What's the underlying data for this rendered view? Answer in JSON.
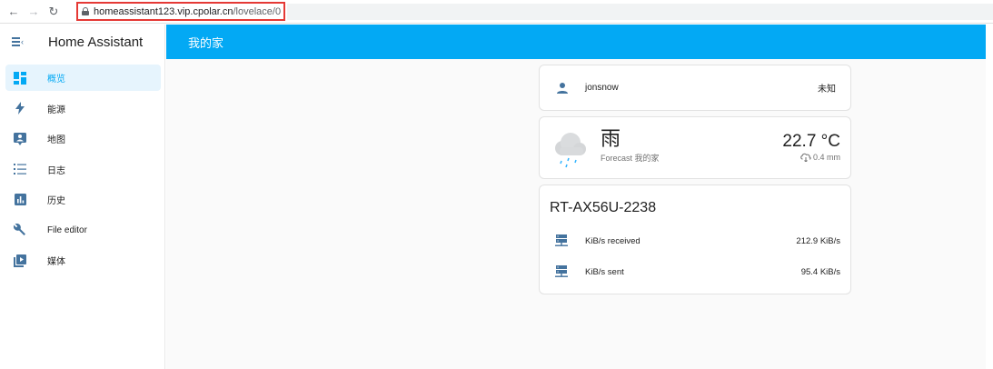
{
  "browser": {
    "url_host": "homeassistant123.vip.cpolar.cn",
    "url_path": "/lovelace/0"
  },
  "sidebar": {
    "app_title": "Home Assistant",
    "items": [
      {
        "label": "概览",
        "icon": "view-dashboard-icon",
        "active": true
      },
      {
        "label": "能源",
        "icon": "lightning-bolt-icon",
        "active": false
      },
      {
        "label": "地图",
        "icon": "account-box-icon",
        "active": false
      },
      {
        "label": "日志",
        "icon": "format-list-bulleted-icon",
        "active": false
      },
      {
        "label": "历史",
        "icon": "chart-box-icon",
        "active": false
      },
      {
        "label": "File editor",
        "icon": "wrench-icon",
        "active": false
      },
      {
        "label": "媒体",
        "icon": "play-box-multiple-icon",
        "active": false
      }
    ]
  },
  "topbar": {
    "title": "我的家"
  },
  "person_card": {
    "name": "jonsnow",
    "state": "未知"
  },
  "weather_card": {
    "condition": "雨",
    "subtitle": "Forecast 我的家",
    "temperature": "22.7 °C",
    "precipitation": "0.4 mm"
  },
  "router_card": {
    "title": "RT-AX56U-2238",
    "rows": [
      {
        "label": "KiB/s received",
        "value": "212.9 KiB/s"
      },
      {
        "label": "KiB/s sent",
        "value": "95.4 KiB/s"
      }
    ]
  },
  "colors": {
    "accent": "#03a9f4",
    "icon": "#44739e",
    "active_bg": "#e6f4fd",
    "url_highlight": "#e53935"
  }
}
